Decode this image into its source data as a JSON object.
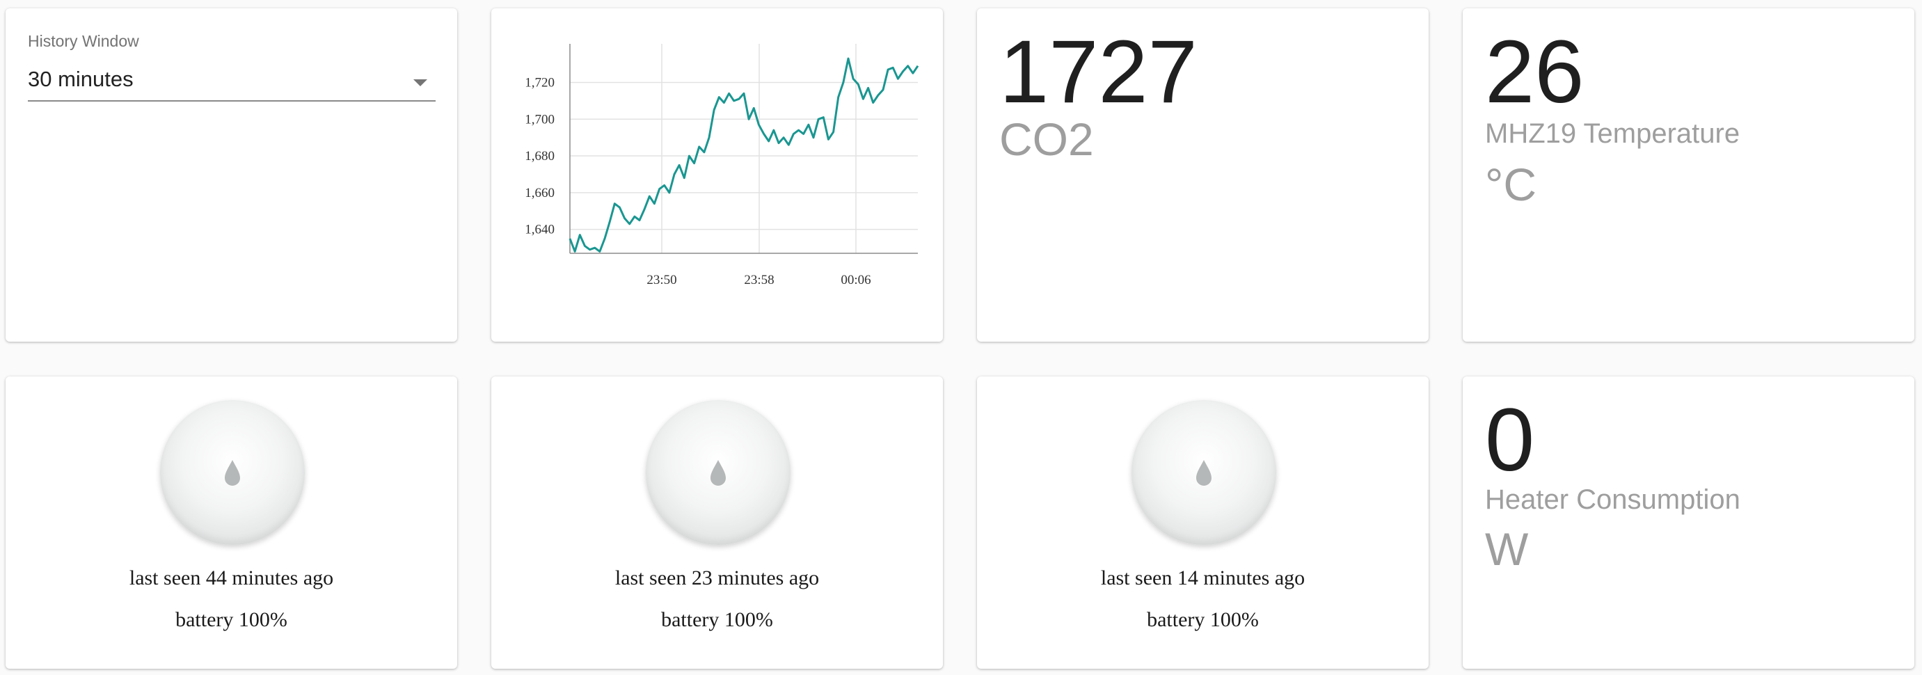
{
  "history": {
    "label": "History Window",
    "value": "30 minutes"
  },
  "chart_data": {
    "type": "line",
    "title": "",
    "xlabel": "",
    "ylabel": "",
    "x_ticks": [
      "23:50",
      "23:58",
      "00:06"
    ],
    "y_ticks": [
      "1,640",
      "1,660",
      "1,680",
      "1,700",
      "1,720"
    ],
    "ylim": [
      1627,
      1741
    ],
    "grid": true,
    "color": "#1a9691",
    "series": [
      {
        "values": [
          1635,
          1628,
          1637,
          1631,
          1629,
          1630,
          1628,
          1635,
          1644,
          1654,
          1652,
          1646,
          1643,
          1647,
          1645,
          1651,
          1658,
          1654,
          1662,
          1664,
          1660,
          1670,
          1675,
          1668,
          1680,
          1676,
          1685,
          1682,
          1690,
          1705,
          1712,
          1709,
          1714,
          1710,
          1711,
          1714,
          1700,
          1706,
          1697,
          1692,
          1688,
          1694,
          1687,
          1690,
          1686,
          1692,
          1694,
          1692,
          1697,
          1690,
          1700,
          1701,
          1689,
          1693,
          1712,
          1720,
          1733,
          1722,
          1719,
          1711,
          1717,
          1709,
          1713,
          1716,
          1727,
          1728,
          1722,
          1726,
          1729,
          1725,
          1729
        ]
      }
    ]
  },
  "co2": {
    "value": "1727",
    "label": "CO2"
  },
  "temperature": {
    "value": "26",
    "label": "MHZ19 Temperature",
    "unit": "°C"
  },
  "sensors": [
    {
      "seen": "last seen 44 minutes ago",
      "battery": "battery 100%",
      "icon": "water-drop-icon"
    },
    {
      "seen": "last seen 23 minutes ago",
      "battery": "battery 100%",
      "icon": "water-drop-icon"
    },
    {
      "seen": "last seen 14 minutes ago",
      "battery": "battery 100%",
      "icon": "water-drop-icon"
    }
  ],
  "heater": {
    "value": "0",
    "label": "Heater Consumption",
    "unit": "W"
  }
}
